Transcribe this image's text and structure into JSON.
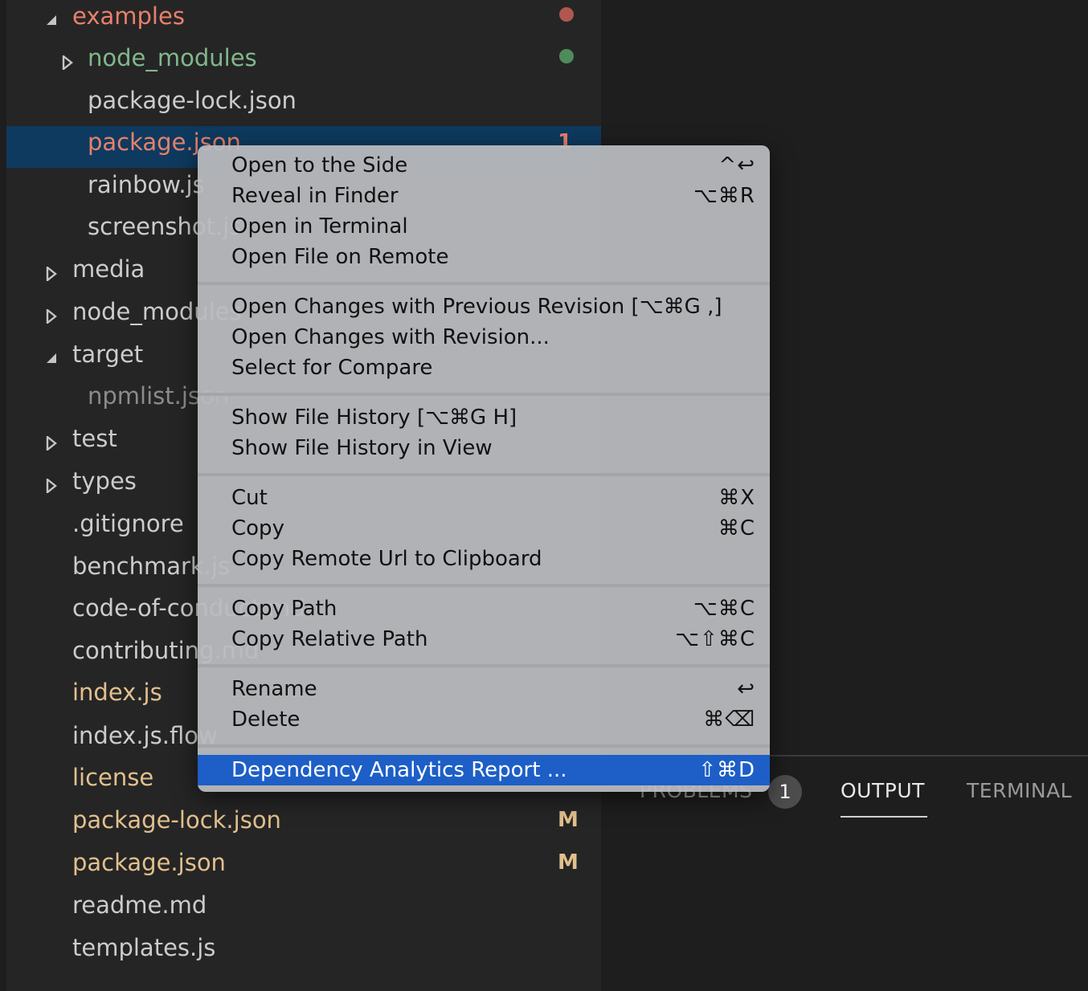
{
  "explorer": {
    "items": [
      {
        "label": "examples",
        "twisty": "expanded",
        "indent": 1,
        "color": "red",
        "dot": "#b0574f"
      },
      {
        "label": "node_modules",
        "twisty": "collapsed",
        "indent": 2,
        "color": "green",
        "dot": "#4e8c5a"
      },
      {
        "label": "package-lock.json",
        "twisty": "none",
        "indent": 2,
        "color": "default"
      },
      {
        "label": "package.json",
        "twisty": "none",
        "indent": 2,
        "color": "red",
        "decoration": "1",
        "selected": true
      },
      {
        "label": "rainbow.js",
        "twisty": "none",
        "indent": 2,
        "color": "default"
      },
      {
        "label": "screenshot.js",
        "twisty": "none",
        "indent": 2,
        "color": "default"
      },
      {
        "label": "media",
        "twisty": "collapsed",
        "indent": 1,
        "color": "default"
      },
      {
        "label": "node_modules",
        "twisty": "collapsed",
        "indent": 1,
        "color": "default"
      },
      {
        "label": "target",
        "twisty": "expanded",
        "indent": 1,
        "color": "default"
      },
      {
        "label": "npmlist.json",
        "twisty": "none",
        "indent": 2,
        "color": "dim"
      },
      {
        "label": "test",
        "twisty": "collapsed",
        "indent": 1,
        "color": "default"
      },
      {
        "label": "types",
        "twisty": "collapsed",
        "indent": 1,
        "color": "default"
      },
      {
        "label": ".gitignore",
        "twisty": "none",
        "indent": 1,
        "color": "default"
      },
      {
        "label": "benchmark.js",
        "twisty": "none",
        "indent": 1,
        "color": "default"
      },
      {
        "label": "code-of-conduct.md",
        "twisty": "none",
        "indent": 1,
        "color": "default"
      },
      {
        "label": "contributing.md",
        "twisty": "none",
        "indent": 1,
        "color": "default"
      },
      {
        "label": "index.js",
        "twisty": "none",
        "indent": 1,
        "color": "yellow"
      },
      {
        "label": "index.js.flow",
        "twisty": "none",
        "indent": 1,
        "color": "default"
      },
      {
        "label": "license",
        "twisty": "none",
        "indent": 1,
        "color": "yellow"
      },
      {
        "label": "package-lock.json",
        "twisty": "none",
        "indent": 1,
        "color": "yellow",
        "decoration": "M"
      },
      {
        "label": "package.json",
        "twisty": "none",
        "indent": 1,
        "color": "yellow",
        "decoration": "M"
      },
      {
        "label": "readme.md",
        "twisty": "none",
        "indent": 1,
        "color": "default"
      },
      {
        "label": "templates.js",
        "twisty": "none",
        "indent": 1,
        "color": "default"
      }
    ]
  },
  "panel": {
    "tabs": [
      {
        "label": "PROBLEMS",
        "active": false
      },
      {
        "label": "OUTPUT",
        "active": true
      },
      {
        "label": "TERMINAL",
        "active": false
      }
    ],
    "problems_badge": "1"
  },
  "context_menu": {
    "groups": [
      [
        {
          "label": "Open to the Side",
          "shortcut": "^↩"
        },
        {
          "label": "Reveal in Finder",
          "shortcut": "⌥⌘R"
        },
        {
          "label": "Open in Terminal",
          "shortcut": ""
        },
        {
          "label": "Open File on Remote",
          "shortcut": ""
        }
      ],
      [
        {
          "label": "Open Changes with Previous Revision [⌥⌘G ,]",
          "shortcut": ""
        },
        {
          "label": "Open Changes with Revision...",
          "shortcut": ""
        },
        {
          "label": "Select for Compare",
          "shortcut": ""
        }
      ],
      [
        {
          "label": "Show File History [⌥⌘G H]",
          "shortcut": ""
        },
        {
          "label": "Show File History in View",
          "shortcut": ""
        }
      ],
      [
        {
          "label": "Cut",
          "shortcut": "⌘X"
        },
        {
          "label": "Copy",
          "shortcut": "⌘C"
        },
        {
          "label": "Copy Remote Url to Clipboard",
          "shortcut": ""
        }
      ],
      [
        {
          "label": "Copy Path",
          "shortcut": "⌥⌘C"
        },
        {
          "label": "Copy Relative Path",
          "shortcut": "⌥⇧⌘C"
        }
      ],
      [
        {
          "label": "Rename",
          "shortcut": "↩"
        },
        {
          "label": "Delete",
          "shortcut": "⌘⌫"
        }
      ],
      [
        {
          "label": "Dependency Analytics Report ...",
          "shortcut": "⇧⌘D",
          "highlighted": true
        }
      ]
    ]
  },
  "colors": {
    "selection": "#0e3a5f",
    "menu_highlight": "#1d5fc7",
    "git_untracked": "#81b88b",
    "git_error": "#e8806b",
    "git_modified": "#e2c08d"
  }
}
